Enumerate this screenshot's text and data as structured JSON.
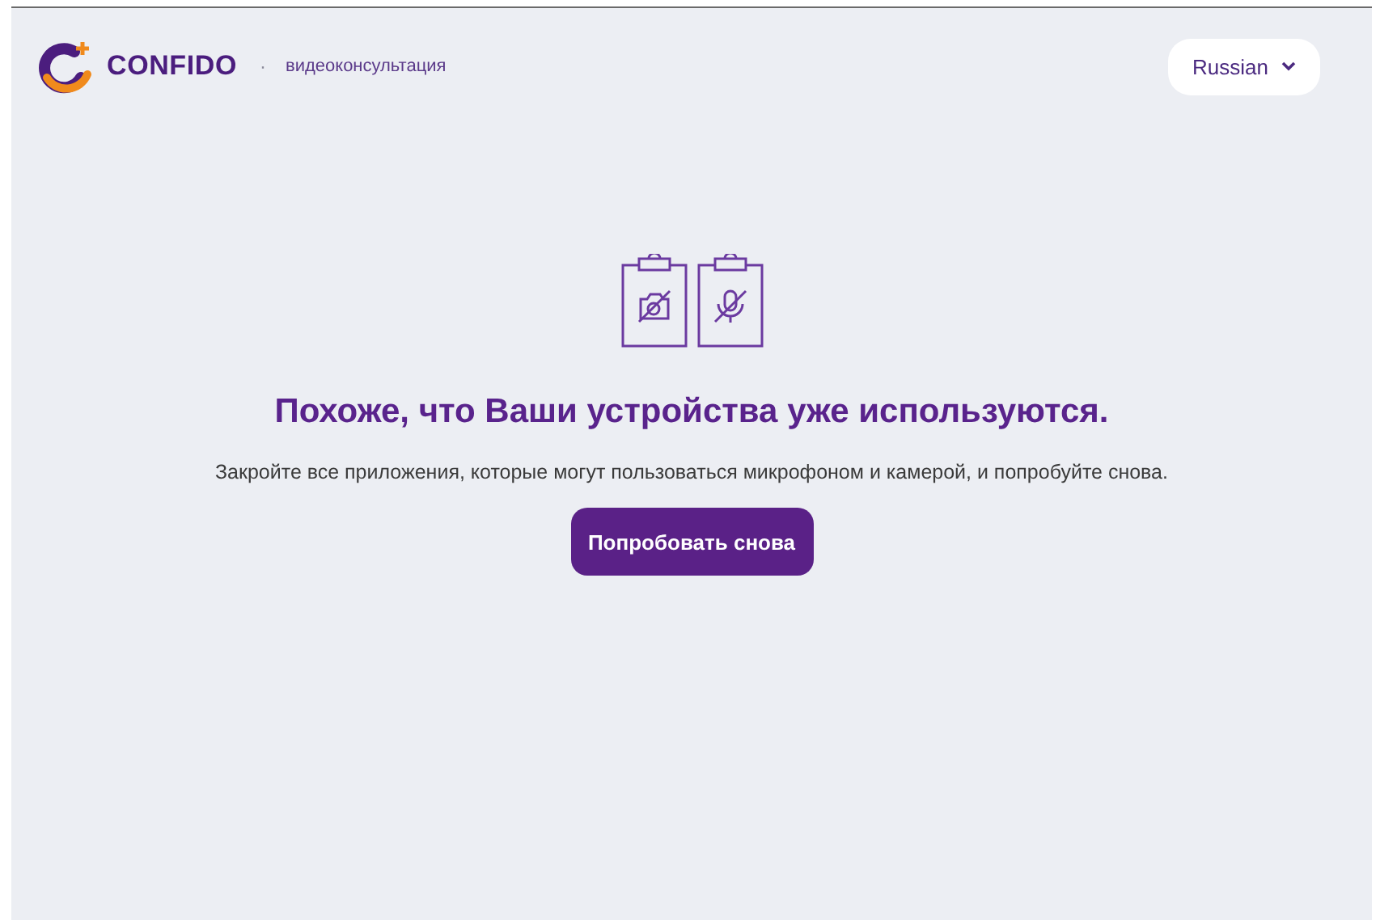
{
  "header": {
    "brand": "CONFIDO",
    "separator": "·",
    "subtitle": "видеоконсультация",
    "language": "Russian"
  },
  "message": {
    "title": "Похоже, что Ваши устройства уже используются.",
    "text": "Закройте все приложения, которые могут пользоваться микрофоном и камерой, и попробуйте снова.",
    "button": "Попробовать снова"
  }
}
